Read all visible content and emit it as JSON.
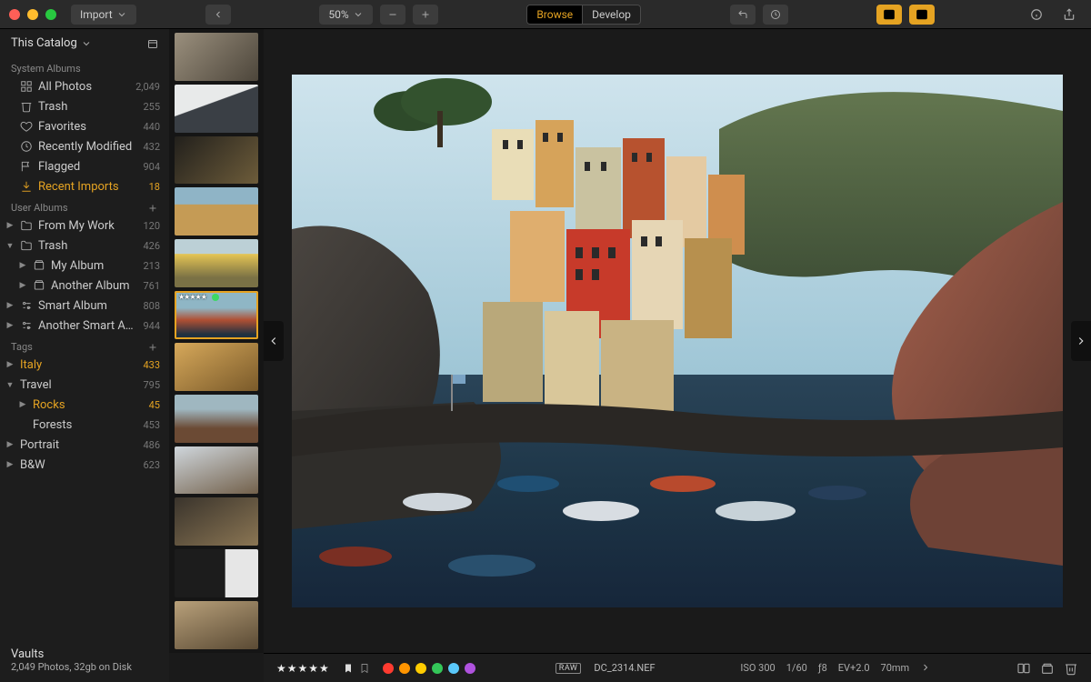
{
  "toolbar": {
    "import_label": "Import",
    "zoom_label": "50%",
    "mode_browse": "Browse",
    "mode_develop": "Develop"
  },
  "sidebar": {
    "catalog_label": "This Catalog",
    "system_albums_header": "System Albums",
    "system_albums": [
      {
        "icon": "grid",
        "label": "All Photos",
        "count": "2,049",
        "selected": false
      },
      {
        "icon": "trash",
        "label": "Trash",
        "count": "255",
        "selected": false
      },
      {
        "icon": "heart",
        "label": "Favorites",
        "count": "440",
        "selected": false
      },
      {
        "icon": "clock",
        "label": "Recently Modified",
        "count": "432",
        "selected": false
      },
      {
        "icon": "flag",
        "label": "Flagged",
        "count": "904",
        "selected": false
      },
      {
        "icon": "import",
        "label": "Recent Imports",
        "count": "18",
        "selected": true
      }
    ],
    "user_albums_header": "User Albums",
    "user_albums": [
      {
        "disclosure": "▶",
        "icon": "folder",
        "indent": 0,
        "label": "From My Work",
        "count": "120",
        "selected": false
      },
      {
        "disclosure": "▼",
        "icon": "folder",
        "indent": 0,
        "label": "Trash",
        "count": "426",
        "selected": false
      },
      {
        "disclosure": "▶",
        "icon": "album",
        "indent": 1,
        "label": "My Album",
        "count": "213",
        "selected": false
      },
      {
        "disclosure": "▶",
        "icon": "album",
        "indent": 1,
        "label": "Another Album",
        "count": "761",
        "selected": false
      },
      {
        "disclosure": "▶",
        "icon": "smart",
        "indent": 0,
        "label": "Smart Album",
        "count": "808",
        "selected": false
      },
      {
        "disclosure": "▶",
        "icon": "smart",
        "indent": 0,
        "label": "Another Smart A…",
        "count": "944",
        "selected": false
      }
    ],
    "tags_header": "Tags",
    "tags": [
      {
        "disclosure": "▶",
        "indent": 0,
        "label": "Italy",
        "count": "433",
        "selected": true
      },
      {
        "disclosure": "▼",
        "indent": 0,
        "label": "Travel",
        "count": "795",
        "selected": false
      },
      {
        "disclosure": "▶",
        "indent": 1,
        "label": "Rocks",
        "count": "45",
        "selected": true
      },
      {
        "disclosure": "",
        "indent": 1,
        "label": "Forests",
        "count": "453",
        "selected": false
      },
      {
        "disclosure": "▶",
        "indent": 0,
        "label": "Portrait",
        "count": "486",
        "selected": false
      },
      {
        "disclosure": "▶",
        "indent": 0,
        "label": "B&W",
        "count": "623",
        "selected": false
      }
    ],
    "vaults_label": "Vaults",
    "vaults_summary": "2,049 Photos, 32gb on Disk"
  },
  "filmstrip": {
    "rating_stars": "★★★★★",
    "thumbs_count": 12,
    "selected_index": 5
  },
  "status": {
    "stars": "★★★★★",
    "raw_badge": "RAW",
    "filename": "DC_2314.NEF",
    "iso": "ISO 300",
    "shutter": "1/60",
    "aperture": "ƒ8",
    "ev": "EV+2.0",
    "focal": "70mm",
    "color_labels": [
      "#ff3b30",
      "#ff9500",
      "#ffcc00",
      "#34c759",
      "#5ac8fa",
      "#af52de"
    ]
  }
}
